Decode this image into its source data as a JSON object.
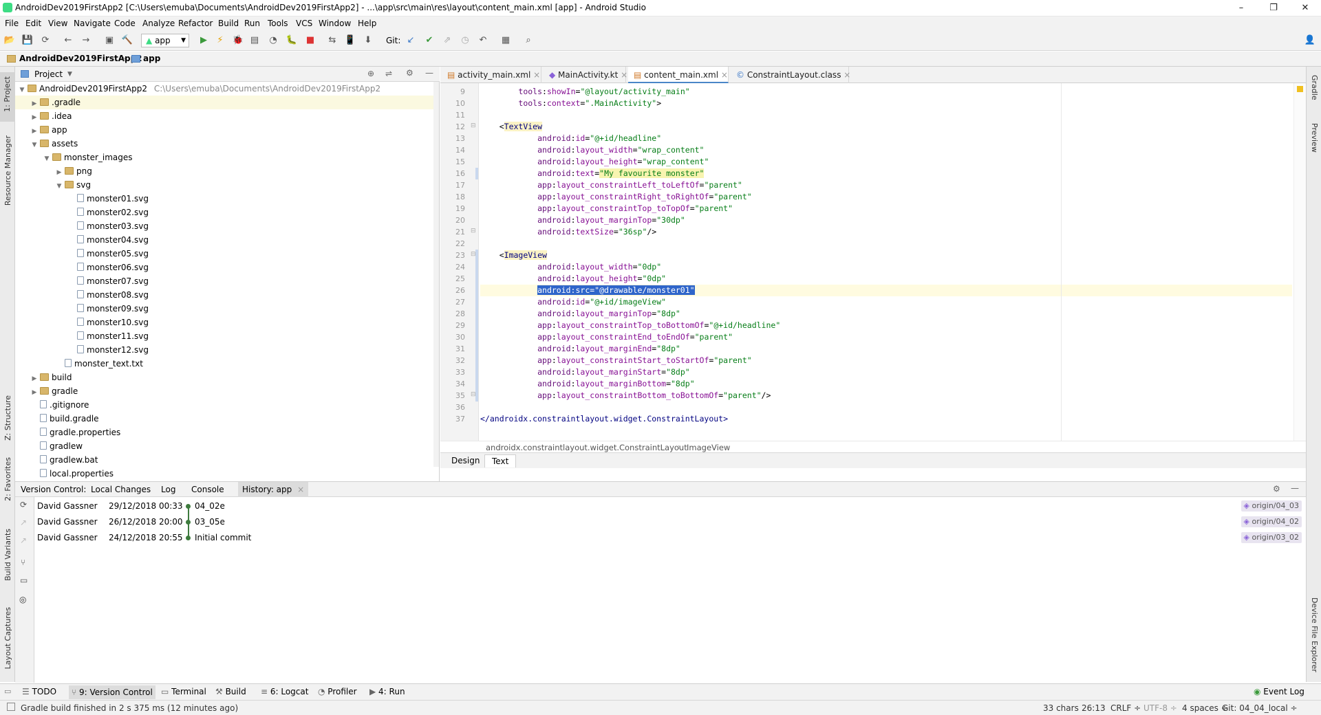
{
  "window": {
    "title": "AndroidDev2019FirstApp2 [C:\\Users\\emuba\\Documents\\AndroidDev2019FirstApp2] - ...\\app\\src\\main\\res\\layout\\content_main.xml [app] - Android Studio",
    "minimize": "–",
    "maximize": "❐",
    "close": "✕"
  },
  "menu": [
    "File",
    "Edit",
    "View",
    "Navigate",
    "Code",
    "Analyze",
    "Refactor",
    "Build",
    "Run",
    "Tools",
    "VCS",
    "Window",
    "Help"
  ],
  "toolbar": {
    "run_config": "app",
    "git_label": "Git:"
  },
  "navbar": {
    "project": "AndroidDev2019FirstApp2",
    "module": "app"
  },
  "left_tools": {
    "project": "1: Project",
    "resource_manager": "Resource Manager",
    "structure": "Z: Structure",
    "favorites": "2: Favorites",
    "build_variants": "Build Variants",
    "layout_captures": "Layout Captures"
  },
  "right_tools": {
    "gradle": "Gradle",
    "preview": "Preview",
    "device_explorer": "Device File Explorer"
  },
  "project_panel": {
    "view_label": "Project",
    "root": {
      "name": "AndroidDev2019FirstApp2",
      "path": "C:\\Users\\emuba\\Documents\\AndroidDev2019FirstApp2"
    },
    "items": [
      {
        "name": ".gradle",
        "type": "folder",
        "level": 1,
        "arrow": "▶"
      },
      {
        "name": ".idea",
        "type": "folder",
        "level": 1,
        "arrow": "▶"
      },
      {
        "name": "app",
        "type": "folder",
        "level": 1,
        "arrow": "▶"
      },
      {
        "name": "assets",
        "type": "folder",
        "level": 1,
        "arrow": "▼"
      },
      {
        "name": "monster_images",
        "type": "folder",
        "level": 2,
        "arrow": "▼"
      },
      {
        "name": "png",
        "type": "folder",
        "level": 3,
        "arrow": "▶"
      },
      {
        "name": "svg",
        "type": "folder",
        "level": 3,
        "arrow": "▼"
      },
      {
        "name": "monster01.svg",
        "type": "file",
        "level": 4,
        "arrow": ""
      },
      {
        "name": "monster02.svg",
        "type": "file",
        "level": 4,
        "arrow": ""
      },
      {
        "name": "monster03.svg",
        "type": "file",
        "level": 4,
        "arrow": ""
      },
      {
        "name": "monster04.svg",
        "type": "file",
        "level": 4,
        "arrow": ""
      },
      {
        "name": "monster05.svg",
        "type": "file",
        "level": 4,
        "arrow": ""
      },
      {
        "name": "monster06.svg",
        "type": "file",
        "level": 4,
        "arrow": ""
      },
      {
        "name": "monster07.svg",
        "type": "file",
        "level": 4,
        "arrow": ""
      },
      {
        "name": "monster08.svg",
        "type": "file",
        "level": 4,
        "arrow": ""
      },
      {
        "name": "monster09.svg",
        "type": "file",
        "level": 4,
        "arrow": ""
      },
      {
        "name": "monster10.svg",
        "type": "file",
        "level": 4,
        "arrow": ""
      },
      {
        "name": "monster11.svg",
        "type": "file",
        "level": 4,
        "arrow": ""
      },
      {
        "name": "monster12.svg",
        "type": "file",
        "level": 4,
        "arrow": ""
      },
      {
        "name": "monster_text.txt",
        "type": "file",
        "level": 3,
        "arrow": ""
      },
      {
        "name": "build",
        "type": "folder",
        "level": 1,
        "arrow": "▶"
      },
      {
        "name": "gradle",
        "type": "folder",
        "level": 1,
        "arrow": "▶"
      },
      {
        "name": ".gitignore",
        "type": "file",
        "level": 1,
        "arrow": ""
      },
      {
        "name": "build.gradle",
        "type": "file",
        "level": 1,
        "arrow": ""
      },
      {
        "name": "gradle.properties",
        "type": "file",
        "level": 1,
        "arrow": ""
      },
      {
        "name": "gradlew",
        "type": "file",
        "level": 1,
        "arrow": ""
      },
      {
        "name": "gradlew.bat",
        "type": "file",
        "level": 1,
        "arrow": ""
      },
      {
        "name": "local.properties",
        "type": "file",
        "level": 1,
        "arrow": ""
      }
    ]
  },
  "editor": {
    "tabs": [
      {
        "label": "activity_main.xml",
        "active": false
      },
      {
        "label": "MainActivity.kt",
        "active": false
      },
      {
        "label": "content_main.xml",
        "active": true
      },
      {
        "label": "ConstraintLayout.class",
        "active": false
      }
    ],
    "lines": [
      {
        "n": "9",
        "indent": "        ",
        "parts": [
          [
            "ns",
            "tools"
          ],
          [
            "txt",
            ":"
          ],
          [
            "attr",
            "showIn"
          ],
          [
            "txt",
            "="
          ],
          [
            "val",
            "\"@layout/activity_main\""
          ]
        ]
      },
      {
        "n": "10",
        "indent": "        ",
        "parts": [
          [
            "ns",
            "tools"
          ],
          [
            "txt",
            ":"
          ],
          [
            "attr",
            "context"
          ],
          [
            "txt",
            "="
          ],
          [
            "val",
            "\".MainActivity\""
          ],
          [
            "txt",
            ">"
          ]
        ]
      },
      {
        "n": "11",
        "indent": "",
        "parts": []
      },
      {
        "n": "12",
        "indent": "    ",
        "parts": [
          [
            "txt",
            "<"
          ],
          [
            "tagbg",
            "TextView"
          ]
        ]
      },
      {
        "n": "13",
        "indent": "            ",
        "parts": [
          [
            "ns",
            "android"
          ],
          [
            "txt",
            ":"
          ],
          [
            "attr",
            "id"
          ],
          [
            "txt",
            "="
          ],
          [
            "val",
            "\"@+id/headline\""
          ]
        ]
      },
      {
        "n": "14",
        "indent": "            ",
        "parts": [
          [
            "ns",
            "android"
          ],
          [
            "txt",
            ":"
          ],
          [
            "attr",
            "layout_width"
          ],
          [
            "txt",
            "="
          ],
          [
            "val",
            "\"wrap_content\""
          ]
        ]
      },
      {
        "n": "15",
        "indent": "            ",
        "parts": [
          [
            "ns",
            "android"
          ],
          [
            "txt",
            ":"
          ],
          [
            "attr",
            "layout_height"
          ],
          [
            "txt",
            "="
          ],
          [
            "val",
            "\"wrap_content\""
          ]
        ]
      },
      {
        "n": "16",
        "indent": "            ",
        "parts": [
          [
            "ns",
            "android"
          ],
          [
            "txt",
            ":"
          ],
          [
            "attr",
            "text"
          ],
          [
            "txt",
            "="
          ],
          [
            "hlv",
            "\"My favourite monster\""
          ]
        ]
      },
      {
        "n": "17",
        "indent": "            ",
        "parts": [
          [
            "ns",
            "app"
          ],
          [
            "txt",
            ":"
          ],
          [
            "attr",
            "layout_constraintLeft_toLeftOf"
          ],
          [
            "txt",
            "="
          ],
          [
            "val",
            "\"parent\""
          ]
        ]
      },
      {
        "n": "18",
        "indent": "            ",
        "parts": [
          [
            "ns",
            "app"
          ],
          [
            "txt",
            ":"
          ],
          [
            "attr",
            "layout_constraintRight_toRightOf"
          ],
          [
            "txt",
            "="
          ],
          [
            "val",
            "\"parent\""
          ]
        ]
      },
      {
        "n": "19",
        "indent": "            ",
        "parts": [
          [
            "ns",
            "app"
          ],
          [
            "txt",
            ":"
          ],
          [
            "attr",
            "layout_constraintTop_toTopOf"
          ],
          [
            "txt",
            "="
          ],
          [
            "val",
            "\"parent\""
          ]
        ]
      },
      {
        "n": "20",
        "indent": "            ",
        "parts": [
          [
            "ns",
            "android"
          ],
          [
            "txt",
            ":"
          ],
          [
            "attr",
            "layout_marginTop"
          ],
          [
            "txt",
            "="
          ],
          [
            "val",
            "\"30dp\""
          ]
        ]
      },
      {
        "n": "21",
        "indent": "            ",
        "parts": [
          [
            "ns",
            "android"
          ],
          [
            "txt",
            ":"
          ],
          [
            "attr",
            "textSize"
          ],
          [
            "txt",
            "="
          ],
          [
            "val",
            "\"36sp\""
          ],
          [
            "txt",
            "/>"
          ]
        ]
      },
      {
        "n": "22",
        "indent": "",
        "parts": []
      },
      {
        "n": "23",
        "indent": "    ",
        "parts": [
          [
            "txt",
            "<"
          ],
          [
            "tagbg",
            "ImageView"
          ]
        ]
      },
      {
        "n": "24",
        "indent": "            ",
        "parts": [
          [
            "ns",
            "android"
          ],
          [
            "txt",
            ":"
          ],
          [
            "attr",
            "layout_width"
          ],
          [
            "txt",
            "="
          ],
          [
            "val",
            "\"0dp\""
          ]
        ]
      },
      {
        "n": "25",
        "indent": "            ",
        "parts": [
          [
            "ns",
            "android"
          ],
          [
            "txt",
            ":"
          ],
          [
            "attr",
            "layout_height"
          ],
          [
            "txt",
            "="
          ],
          [
            "val",
            "\"0dp\""
          ]
        ]
      },
      {
        "n": "26",
        "indent": "            ",
        "parts": [
          [
            "sel",
            "android:src=\"@drawable/monster01\""
          ]
        ],
        "current": true
      },
      {
        "n": "27",
        "indent": "            ",
        "parts": [
          [
            "ns",
            "android"
          ],
          [
            "txt",
            ":"
          ],
          [
            "attr",
            "id"
          ],
          [
            "txt",
            "="
          ],
          [
            "val",
            "\"@+id/imageView\""
          ]
        ]
      },
      {
        "n": "28",
        "indent": "            ",
        "parts": [
          [
            "ns",
            "android"
          ],
          [
            "txt",
            ":"
          ],
          [
            "attr",
            "layout_marginTop"
          ],
          [
            "txt",
            "="
          ],
          [
            "val",
            "\"8dp\""
          ]
        ]
      },
      {
        "n": "29",
        "indent": "            ",
        "parts": [
          [
            "ns",
            "app"
          ],
          [
            "txt",
            ":"
          ],
          [
            "attr",
            "layout_constraintTop_toBottomOf"
          ],
          [
            "txt",
            "="
          ],
          [
            "val",
            "\"@+id/headline\""
          ]
        ]
      },
      {
        "n": "30",
        "indent": "            ",
        "parts": [
          [
            "ns",
            "app"
          ],
          [
            "txt",
            ":"
          ],
          [
            "attr",
            "layout_constraintEnd_toEndOf"
          ],
          [
            "txt",
            "="
          ],
          [
            "val",
            "\"parent\""
          ]
        ]
      },
      {
        "n": "31",
        "indent": "            ",
        "parts": [
          [
            "ns",
            "android"
          ],
          [
            "txt",
            ":"
          ],
          [
            "attr",
            "layout_marginEnd"
          ],
          [
            "txt",
            "="
          ],
          [
            "val",
            "\"8dp\""
          ]
        ]
      },
      {
        "n": "32",
        "indent": "            ",
        "parts": [
          [
            "ns",
            "app"
          ],
          [
            "txt",
            ":"
          ],
          [
            "attr",
            "layout_constraintStart_toStartOf"
          ],
          [
            "txt",
            "="
          ],
          [
            "val",
            "\"parent\""
          ]
        ]
      },
      {
        "n": "33",
        "indent": "            ",
        "parts": [
          [
            "ns",
            "android"
          ],
          [
            "txt",
            ":"
          ],
          [
            "attr",
            "layout_marginStart"
          ],
          [
            "txt",
            "="
          ],
          [
            "val",
            "\"8dp\""
          ]
        ]
      },
      {
        "n": "34",
        "indent": "            ",
        "parts": [
          [
            "ns",
            "android"
          ],
          [
            "txt",
            ":"
          ],
          [
            "attr",
            "layout_marginBottom"
          ],
          [
            "txt",
            "="
          ],
          [
            "val",
            "\"8dp\""
          ]
        ]
      },
      {
        "n": "35",
        "indent": "            ",
        "parts": [
          [
            "ns",
            "app"
          ],
          [
            "txt",
            ":"
          ],
          [
            "attr",
            "layout_constraintBottom_toBottomOf"
          ],
          [
            "txt",
            "="
          ],
          [
            "val",
            "\"parent\""
          ],
          [
            "txt",
            "/>"
          ]
        ]
      },
      {
        "n": "36",
        "indent": "",
        "parts": []
      },
      {
        "n": "37",
        "indent": "",
        "parts": [
          [
            "tag",
            "</androidx.constraintlayout.widget.ConstraintLayout>"
          ]
        ]
      }
    ],
    "breadcrumb": [
      "androidx.constraintlayout.widget.ConstraintLayout",
      "ImageView"
    ],
    "design_tabs": [
      "Design",
      "Text"
    ]
  },
  "vc_panel": {
    "tabs": [
      "Version Control:",
      "Local Changes",
      "Log",
      "Console",
      "History: app"
    ],
    "commits": [
      {
        "author": "David Gassner",
        "date": "29/12/2018 00:33",
        "message": "04_02e",
        "branch": "origin/04_03"
      },
      {
        "author": "David Gassner",
        "date": "26/12/2018 20:00",
        "message": "03_05e",
        "branch": "origin/04_02"
      },
      {
        "author": "David Gassner",
        "date": "24/12/2018 20:55",
        "message": "Initial commit",
        "branch": "origin/03_02"
      }
    ]
  },
  "bottom_tabs": {
    "todo": "TODO",
    "version_control": "9: Version Control",
    "terminal": "Terminal",
    "build": "Build",
    "logcat": "6: Logcat",
    "profiler": "Profiler",
    "run": "4: Run",
    "event_log": "Event Log"
  },
  "status": {
    "message": "Gradle build finished in 2 s 375 ms (12 minutes ago)",
    "chars": "33 chars",
    "position": "26:13",
    "line_sep": "CRLF ÷",
    "encoding": "UTF-8 ÷",
    "indent": "4 spaces ÷",
    "git": "Git: 04_04_local ÷"
  }
}
